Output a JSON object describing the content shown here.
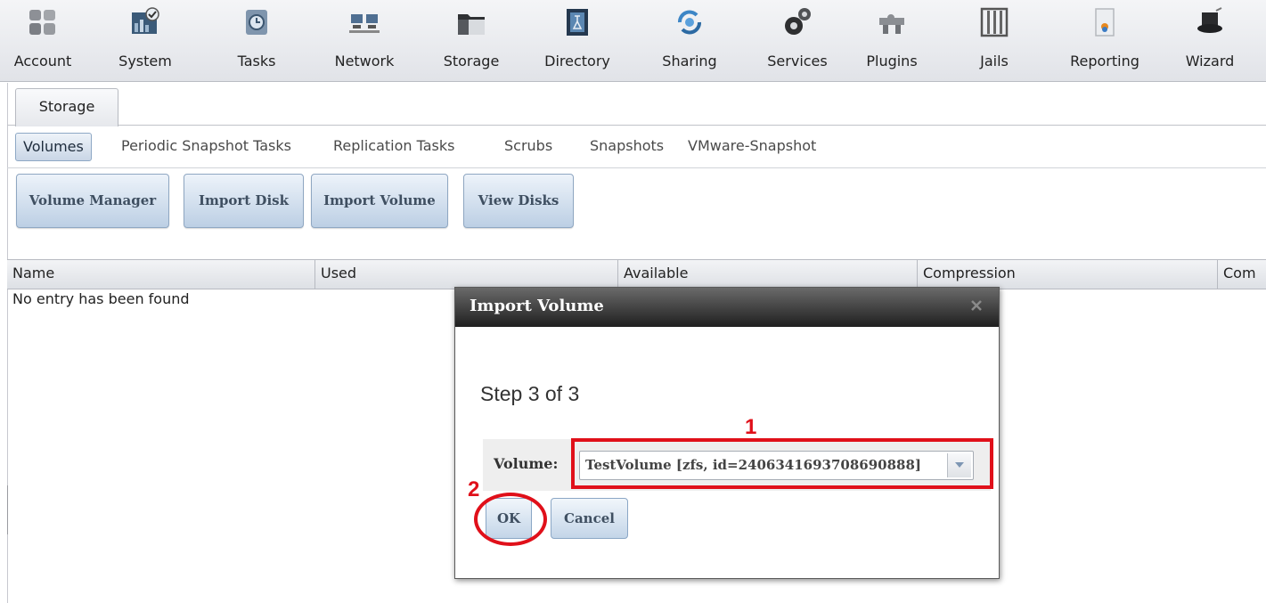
{
  "toolbar": {
    "items": [
      {
        "label": "Account",
        "icon": "users-icon"
      },
      {
        "label": "System",
        "icon": "system-monitor-icon"
      },
      {
        "label": "Tasks",
        "icon": "calendar-clock-icon"
      },
      {
        "label": "Network",
        "icon": "network-icon"
      },
      {
        "label": "Storage",
        "icon": "folder-icon"
      },
      {
        "label": "Directory",
        "icon": "directory-book-icon"
      },
      {
        "label": "Sharing",
        "icon": "sharing-icon"
      },
      {
        "label": "Services",
        "icon": "gears-icon"
      },
      {
        "label": "Plugins",
        "icon": "puzzle-icon"
      },
      {
        "label": "Jails",
        "icon": "jail-bars-icon"
      },
      {
        "label": "Reporting",
        "icon": "report-icon"
      },
      {
        "label": "Wizard",
        "icon": "wizard-hat-icon"
      }
    ]
  },
  "tabs": {
    "storage": "Storage"
  },
  "subtabs": {
    "volumes": "Volumes",
    "periodic": "Periodic Snapshot Tasks",
    "replication": "Replication Tasks",
    "scrubs": "Scrubs",
    "snapshots": "Snapshots",
    "vmware": "VMware-Snapshot"
  },
  "actions": {
    "volume_manager": "Volume Manager",
    "import_disk": "Import Disk",
    "import_volume": "Import Volume",
    "view_disks": "View Disks"
  },
  "table": {
    "columns": [
      "Name",
      "Used",
      "Available",
      "Compression",
      "Com"
    ],
    "empty_message": "No entry has been found"
  },
  "dialog": {
    "title": "Import Volume",
    "step": "Step 3 of 3",
    "volume_label": "Volume:",
    "volume_value": "TestVolume [zfs, id=2406341693708690888]",
    "ok": "OK",
    "cancel": "Cancel"
  },
  "annotations": {
    "label_1": "1",
    "label_2": "2",
    "color": "#e0101a"
  },
  "colors": {
    "button_gradient_top": "#edf3fa",
    "button_gradient_bottom": "#bccfe4",
    "dialog_titlebar": "#1f1f1f"
  }
}
